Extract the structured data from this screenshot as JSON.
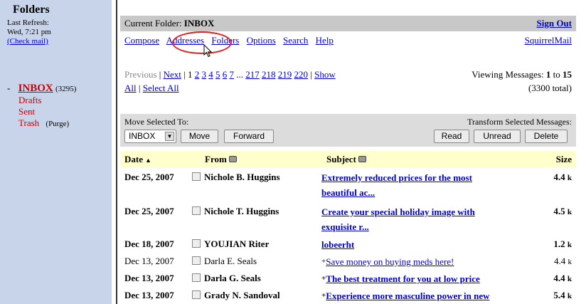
{
  "left": {
    "title": "Folders",
    "last_refresh_label": "Last Refresh:",
    "last_refresh_time": "Wed, 7:21 pm",
    "check_mail": "(Check mail)",
    "bullet": "-",
    "inbox_label": "INBOX",
    "inbox_count": "(3295)",
    "folders": [
      "Drafts",
      "Sent",
      "Trash"
    ],
    "purge": "(Purge)"
  },
  "header": {
    "current_folder_label": "Current Folder:",
    "current_folder": "INBOX",
    "sign_out": "Sign Out",
    "brand": "SquirrelMail"
  },
  "menu": [
    "Compose",
    "Addresses",
    "Folders",
    "Options",
    "Search",
    "Help"
  ],
  "paging": {
    "previous": "Previous",
    "next": "Next",
    "current": "1",
    "pages": [
      "2",
      "3",
      "4",
      "5",
      "6",
      "7"
    ],
    "ellipsis": "...",
    "tail_pages": [
      "217",
      "218",
      "219",
      "220"
    ],
    "show": "Show",
    "all": "All",
    "select_all": "Select All",
    "viewing_prefix": "Viewing Messages:",
    "from": "1",
    "to_word": "to",
    "to": "15",
    "total": "(3300 total)"
  },
  "actions": {
    "move_label": "Move Selected To:",
    "folder_select": "INBOX",
    "move": "Move",
    "forward": "Forward",
    "transform_label": "Transform Selected Messages:",
    "read": "Read",
    "unread": "Unread",
    "delete": "Delete"
  },
  "table": {
    "columns": {
      "date": "Date",
      "from": "From",
      "subject": "Subject",
      "size": "Size"
    },
    "rows": [
      {
        "date": "Dec 25, 2007",
        "from": "Nichole B. Huggins",
        "subject_lines": [
          "Extremely reduced prices for the most",
          "beautiful ac..."
        ],
        "size": "4.4",
        "unit": "k",
        "bold": true,
        "plus": false
      },
      {
        "date": "Dec 25, 2007",
        "from": "Nichole T. Huggins",
        "subject_lines": [
          "Create your special holiday image with",
          "exquisite r..."
        ],
        "size": "4.5",
        "unit": "k",
        "bold": true,
        "plus": false
      },
      {
        "date": "Dec 18, 2007",
        "from": "YOUJIAN Riter",
        "subject_lines": [
          "lobeerht"
        ],
        "size": "1.2",
        "unit": "k",
        "bold": true,
        "plus": false
      },
      {
        "date": "Dec 13, 2007",
        "from": "Darla E. Seals",
        "subject_lines": [
          "Save money on buying meds here!"
        ],
        "size": "4.4",
        "unit": "k",
        "bold": false,
        "plus": true
      },
      {
        "date": "Dec 13, 2007",
        "from": "Darla G. Seals",
        "subject_lines": [
          "The best treatment for you at low price"
        ],
        "size": "4.4",
        "unit": "k",
        "bold": true,
        "plus": true
      },
      {
        "date": "Dec 13, 2007",
        "from": "Grady N. Sandoval",
        "subject_lines": [
          "Experience more masculine power in new"
        ],
        "size": "5.4",
        "unit": "k",
        "bold": true,
        "plus": true
      }
    ]
  },
  "colors": {
    "sidebar_bg": "#c8d4ea",
    "header_bg": "#c8c8c8",
    "table_header_bg": "#ffffcc",
    "highlight_oval": "#e02020",
    "link": "#0000cc",
    "folder_red": "#cc0000"
  }
}
